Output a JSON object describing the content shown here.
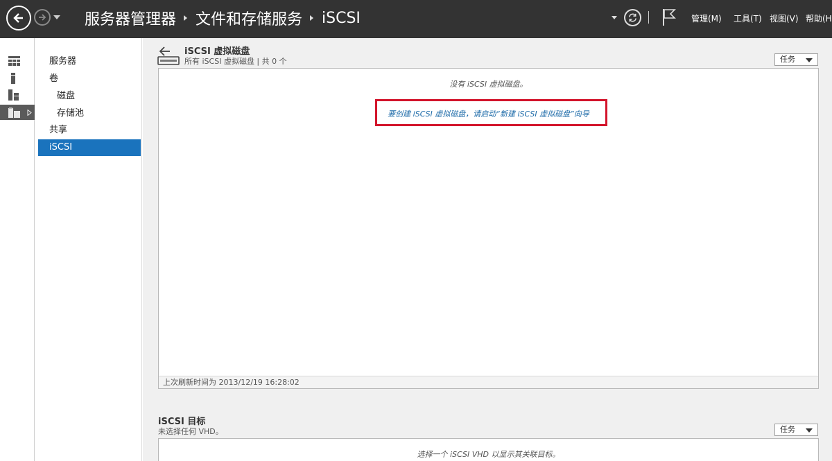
{
  "titlebar": {
    "breadcrumb": [
      "服务器管理器",
      "文件和存储服务",
      "iSCSI"
    ],
    "menus": [
      "管理(M)",
      "工具(T)",
      "视图(V)",
      "帮助(H)"
    ]
  },
  "rail": {
    "items": [
      "dashboard-icon",
      "local-server-icon",
      "all-servers-icon",
      "file-storage-icon"
    ],
    "active_index": 3
  },
  "nav": {
    "items": [
      {
        "label": "服务器",
        "level": 0
      },
      {
        "label": "卷",
        "level": 0
      },
      {
        "label": "磁盘",
        "level": 1
      },
      {
        "label": "存储池",
        "level": 1
      },
      {
        "label": "共享",
        "level": 0
      },
      {
        "label": "iSCSI",
        "level": 0,
        "selected": true
      }
    ]
  },
  "virtual_disks": {
    "title": "iSCSI 虚拟磁盘",
    "subtitle": "所有 iSCSI 虚拟磁盘 | 共 0 个",
    "tasks_label": "任务",
    "empty_message": "没有 iSCSI 虚拟磁盘。",
    "wizard_link": "要创建 iSCSI 虚拟磁盘，请启动“新建 iSCSI 虚拟磁盘”向导",
    "last_refresh": "上次刷新时间为 2013/12/19 16:28:02"
  },
  "targets": {
    "title": "iSCSI 目标",
    "subtitle": "未选择任何 VHD。",
    "tasks_label": "任务",
    "empty_message": "选择一个 iSCSI VHD 以显示其关联目标。"
  },
  "colors": {
    "titlebar_bg": "#333333",
    "selected_nav": "#1a73bd",
    "link": "#1c6aa8",
    "highlight": "#d3142b"
  }
}
